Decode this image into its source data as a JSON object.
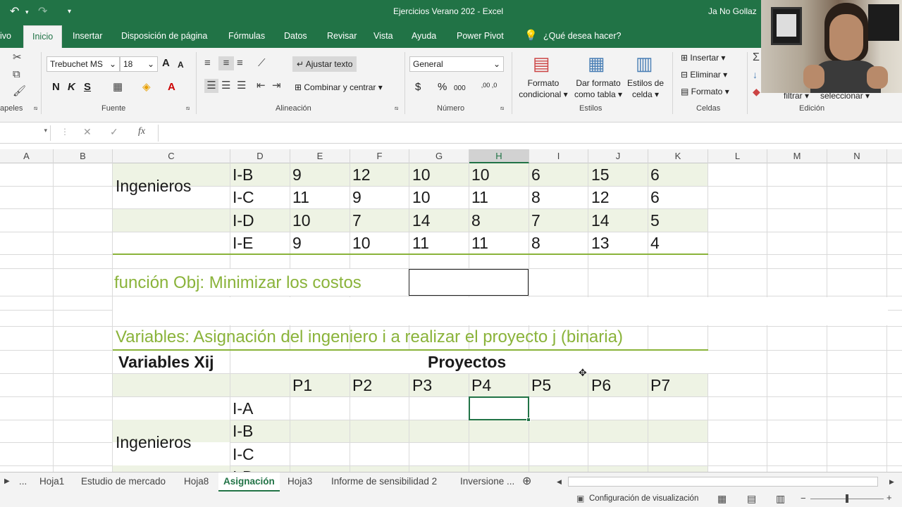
{
  "titlebar": {
    "undo": "↶",
    "redo": "↷",
    "customize": "▾",
    "title": "Ejercicios Verano 202  -  Excel",
    "user": "Ja No Gollaz"
  },
  "tabs": [
    "ivo",
    "Inicio",
    "Insertar",
    "Disposición de página",
    "Fórmulas",
    "Datos",
    "Revisar",
    "Vista",
    "Ayuda",
    "Power Pivot"
  ],
  "tell_me": "¿Qué desea hacer?",
  "ribbon": {
    "clipboard_label": "apeles",
    "font": {
      "name": "Trebuchet MS",
      "size": "18",
      "grow": "A",
      "shrink": "A",
      "bold": "N",
      "italic": "K",
      "underline": "S",
      "label": "Fuente"
    },
    "alignment": {
      "wrap": "Ajustar texto",
      "merge": "Combinar y centrar",
      "label": "Alineación"
    },
    "number": {
      "format": "General",
      "currency": "$",
      "percent": "%",
      "thousands": "000",
      "inc_dec": ",00 ,0",
      "label": "Número"
    },
    "styles": {
      "cond_1": "Formato",
      "cond_2": "condicional",
      "table_1": "Dar formato",
      "table_2": "como tabla",
      "cell_1": "Estilos de",
      "cell_2": "celda",
      "label": "Estilos"
    },
    "cells": {
      "insert": "Insertar",
      "delete": "Eliminar",
      "format": "Formato",
      "label": "Celdas"
    },
    "editing": {
      "filter": "filtrar",
      "select": "seleccionar",
      "label": "Edición"
    }
  },
  "formula_bar": {
    "cancel": "✕",
    "confirm": "✓",
    "fx": "fx"
  },
  "columns": [
    "A",
    "B",
    "C",
    "D",
    "E",
    "F",
    "G",
    "H",
    "I",
    "J",
    "K",
    "L",
    "M",
    "N"
  ],
  "selected_column": "H",
  "sheet": {
    "engineers_label": "Ingenieros",
    "cost_rows": [
      {
        "eng": "I-B",
        "values": [
          "9",
          "12",
          "10",
          "10",
          "6",
          "15",
          "6"
        ]
      },
      {
        "eng": "I-C",
        "values": [
          "11",
          "9",
          "10",
          "11",
          "8",
          "12",
          "6"
        ]
      },
      {
        "eng": "I-D",
        "values": [
          "10",
          "7",
          "14",
          "8",
          "7",
          "14",
          "5"
        ]
      },
      {
        "eng": "I-E",
        "values": [
          "9",
          "10",
          "11",
          "11",
          "8",
          "13",
          "4"
        ]
      }
    ],
    "objective": "función Obj: Minimizar los costos",
    "variables_title": "Variables: Asignación del ingeniero i a realizar el proyecto j (binaria)",
    "variables_header": "Variables Xij",
    "projects_header": "Proyectos",
    "projects": [
      "P1",
      "P2",
      "P3",
      "P4",
      "P5",
      "P6",
      "P7"
    ],
    "var_engineers": [
      "I-A",
      "I-B",
      "I-C",
      "I-D"
    ],
    "engineers_label_2": "Ingenieros"
  },
  "sheet_tabs": [
    "...",
    "Hoja1",
    "Estudio de mercado",
    "Hoja8",
    "Asignación",
    "Hoja3",
    "Informe de sensibilidad 2",
    "Inversione ..."
  ],
  "active_sheet": "Asignación",
  "statusbar": {
    "display_settings": "Configuración de visualización"
  },
  "colors": {
    "excel_green": "#217346",
    "accent_text": "#8ab33a",
    "band": "#eef3e4"
  }
}
